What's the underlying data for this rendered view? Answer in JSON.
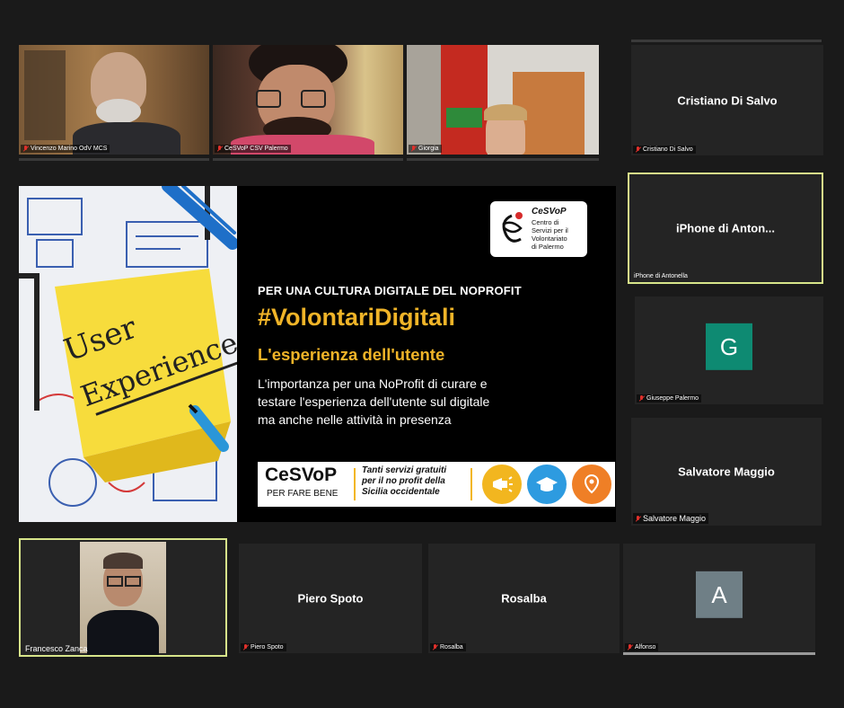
{
  "participants": {
    "top": [
      {
        "name": "Vincenzo Marino OdV MCS",
        "muted": true
      },
      {
        "name": "CeSVoP CSV Palermo",
        "muted": true
      },
      {
        "name": "Giorgia",
        "muted": true
      }
    ],
    "side": [
      {
        "display": "Cristiano Di Salvo",
        "name": "Cristiano Di Salvo",
        "muted": true
      },
      {
        "display": "iPhone  di  Anton...",
        "name": "iPhone di Antonella",
        "muted": false
      },
      {
        "initial": "G",
        "name": "Giuseppe Palermo",
        "muted": true,
        "color": "#0e8a72"
      },
      {
        "display": "Salvatore Maggio",
        "name": "Salvatore Maggio",
        "muted": true
      }
    ],
    "bottom": [
      {
        "name": "Francesco Zanca",
        "muted": false
      },
      {
        "display": "Piero Spoto",
        "name": "Piero Spoto",
        "muted": true
      },
      {
        "display": "Rosalba",
        "name": "Rosalba",
        "muted": true
      },
      {
        "initial": "A",
        "name": "Alfonso",
        "muted": true,
        "color": "#6f7f86"
      }
    ]
  },
  "slide": {
    "sticky_line1": "User",
    "sticky_line2": "Experience",
    "logo_brand": "CeSVoP",
    "logo_line1": "Centro di",
    "logo_line2": "Servizi per il",
    "logo_line3": "Volontariato",
    "logo_line4": "di Palermo",
    "kicker": "PER UNA CULTURA DIGITALE DEL NOPROFIT",
    "hashtag": "#VolontariDigitali",
    "subtitle": "L'esperienza dell'utente",
    "body_line1": "L'importanza per una NoProfit di curare e",
    "body_line2": "testare l'esperienza dell'utente sul digitale",
    "body_line3": "ma anche nelle attività in presenza",
    "banner_brand": "CeSVoP",
    "banner_tagline": "PER FARE BENE",
    "banner_line1": "Tanti servizi gratuiti",
    "banner_line2": "per il no profit della",
    "banner_line3": "Sicilia occidentale"
  },
  "colors": {
    "accent_yellow": "#f0b428",
    "speaker_border": "#d7e58a",
    "muted_red": "#e0302b",
    "banner_blue": "#2d9be0",
    "banner_orange": "#ef7f26",
    "banner_yellow": "#f2b61f"
  },
  "icons": [
    "microphone-muted-icon",
    "megaphone-icon",
    "graduation-cap-icon",
    "map-pin-icon"
  ]
}
